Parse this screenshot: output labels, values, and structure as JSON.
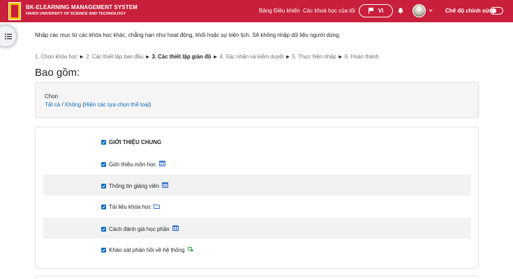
{
  "brand": {
    "title": "BK-ELEARNING MANAGEMENT SYSTEM",
    "subtitle": "HANOI UNIVERSITY OF SCIENCE AND TECHNOLOGY"
  },
  "nav": {
    "dashboard": "Bảng Điều khiển",
    "my_courses": "Các khoá học của tôi",
    "language": "VI",
    "edit_mode": "Chế độ chỉnh sửa"
  },
  "intro_text": "Nhập các mục từ các khóa học khác, chẳng hạn như hoạt động, khối hoặc sự kiện lịch. Sẽ không nhập dữ liệu người dùng.",
  "steps": [
    {
      "label": "1. Chọn khóa học",
      "current": false
    },
    {
      "label": "2. Các thiết lập ban đầu",
      "current": false
    },
    {
      "label": "3. Các thiết lập giản đồ",
      "current": true
    },
    {
      "label": "4. Xác nhận và kiểm duyệt",
      "current": false
    },
    {
      "label": "5. Thực hiện nhập",
      "current": false
    },
    {
      "label": "6. Hoàn thành",
      "current": false
    }
  ],
  "step_separator": "►",
  "heading": "Bao gồm:",
  "select": {
    "label": "Chọn",
    "all": "Tất cả",
    "slash": " / ",
    "none": "Không",
    "open_paren": " (",
    "show_types": "Hiện các lựa chọn thể loại",
    "close_paren": ")"
  },
  "items": [
    {
      "label": "GIỚI THIỆU CHUNG",
      "checked": true,
      "icon": "none",
      "bold": true
    },
    {
      "label": "Giới thiệu môn học",
      "checked": true,
      "icon": "page-icon",
      "bold": false
    },
    {
      "label": "Thông tin giảng viên",
      "checked": true,
      "icon": "page-icon",
      "bold": false
    },
    {
      "label": "Tài liệu khóa học",
      "checked": true,
      "icon": "folder-icon",
      "bold": false
    },
    {
      "label": "Cách đánh giá học phần",
      "checked": true,
      "icon": "page-icon",
      "bold": false
    },
    {
      "label": "Khảo sát phản hồi về hệ thống",
      "checked": true,
      "icon": "feedback-icon",
      "bold": false
    }
  ],
  "colors": {
    "navbar": "#c8203c",
    "link": "#0f6cbf",
    "checkbox": "#0f6cbf"
  }
}
